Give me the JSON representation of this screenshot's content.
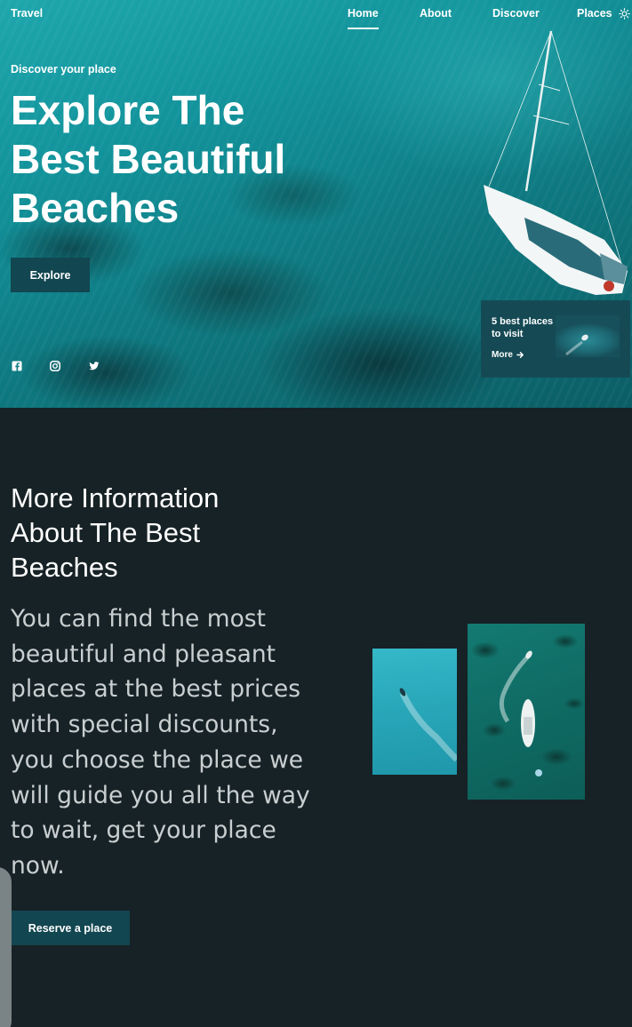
{
  "brand": "Travel",
  "nav": {
    "items": [
      {
        "label": "Home",
        "active": true
      },
      {
        "label": "About",
        "active": false
      },
      {
        "label": "Discover",
        "active": false
      },
      {
        "label": "Places",
        "active": false
      }
    ],
    "theme_toggle_icon": "sun-icon"
  },
  "hero": {
    "subtitle": "Discover your place",
    "headline": {
      "line1": "Explore The",
      "line2_regular": "Best ",
      "line2_bold": "Beautiful",
      "line3_bold": "Beaches"
    },
    "cta_label": "Explore",
    "social_icons": [
      "facebook-icon",
      "instagram-icon",
      "twitter-icon"
    ],
    "card": {
      "title": "5 best places to visit",
      "more_label": "More",
      "more_icon": "arrow-right-icon"
    }
  },
  "info": {
    "title": "More Information About The Best Beaches",
    "text": "You can find the most beautiful and pleasant places at the best prices with special discounts, you choose the place we will guide you all the way to wait, get your place now.",
    "cta_label": "Reserve a place"
  },
  "colors": {
    "background": "#172226",
    "button": "#124650",
    "card": "#154a55",
    "ocean": "#12929a"
  }
}
